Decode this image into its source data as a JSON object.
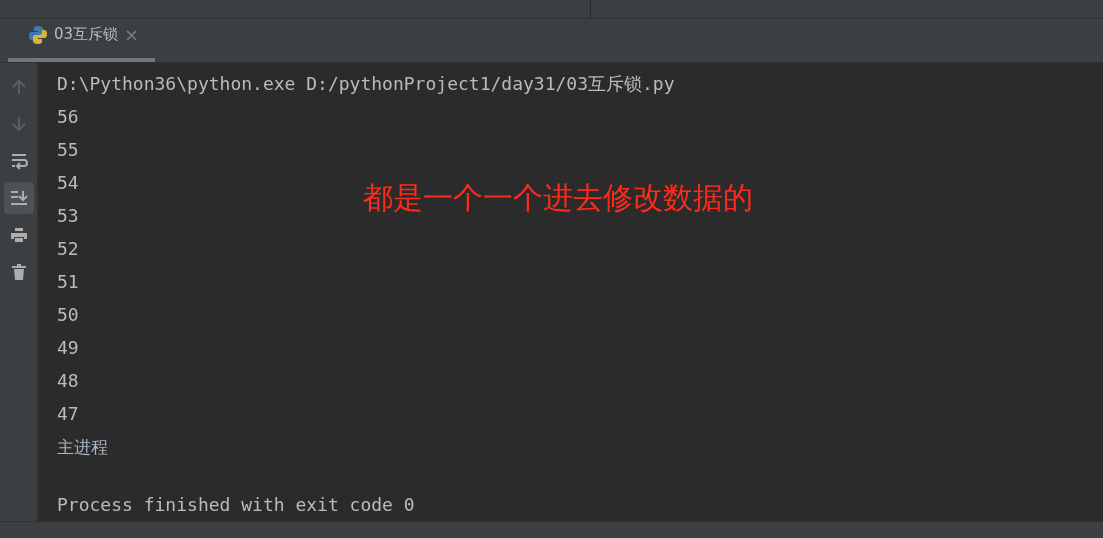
{
  "tabs": [
    {
      "label": "03互斥锁",
      "close": "×",
      "selected": true
    }
  ],
  "toolbar": [
    {
      "kind": "up",
      "disabled": true,
      "selected": false
    },
    {
      "kind": "down",
      "disabled": true,
      "selected": false
    },
    {
      "kind": "wrap",
      "disabled": false,
      "selected": false
    },
    {
      "kind": "scroll-end",
      "disabled": false,
      "selected": true
    },
    {
      "kind": "print",
      "disabled": false,
      "selected": false
    },
    {
      "kind": "trash",
      "disabled": false,
      "selected": false
    }
  ],
  "console": [
    {
      "kind": "command",
      "text": "D:\\Python36\\python.exe D:/pythonProject1/day31/03互斥锁.py"
    },
    {
      "kind": "output",
      "text": "56"
    },
    {
      "kind": "output",
      "text": "55"
    },
    {
      "kind": "output",
      "text": "54"
    },
    {
      "kind": "output",
      "text": "53"
    },
    {
      "kind": "output",
      "text": "52"
    },
    {
      "kind": "output",
      "text": "51"
    },
    {
      "kind": "output",
      "text": "50"
    },
    {
      "kind": "output",
      "text": "49"
    },
    {
      "kind": "output",
      "text": "48"
    },
    {
      "kind": "output",
      "text": "47"
    },
    {
      "kind": "output",
      "text": "主进程"
    },
    {
      "kind": "blank"
    },
    {
      "kind": "exit",
      "text": "Process finished with exit code 0"
    }
  ],
  "annotation": "都是一个一个进去修改数据的"
}
